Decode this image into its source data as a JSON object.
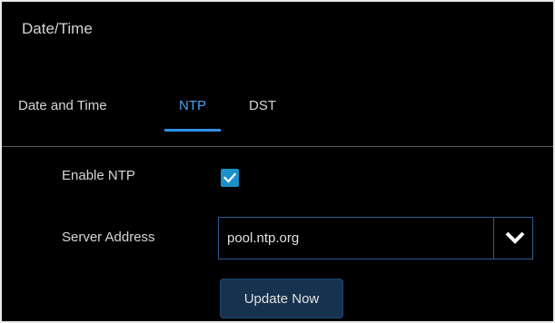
{
  "header": {
    "title": "Date/Time"
  },
  "tabs": [
    {
      "label": "Date and Time",
      "active": false
    },
    {
      "label": "NTP",
      "active": true
    },
    {
      "label": "DST",
      "active": false
    }
  ],
  "ntp": {
    "enable_label": "Enable NTP",
    "enable_checked": true,
    "server_label": "Server Address",
    "server_value": "pool.ntp.org",
    "update_button": "Update Now"
  },
  "colors": {
    "accent": "#2f8fe6",
    "checkbox": "#1d8fc9",
    "button_bg": "#16324f",
    "background": "#000000"
  }
}
